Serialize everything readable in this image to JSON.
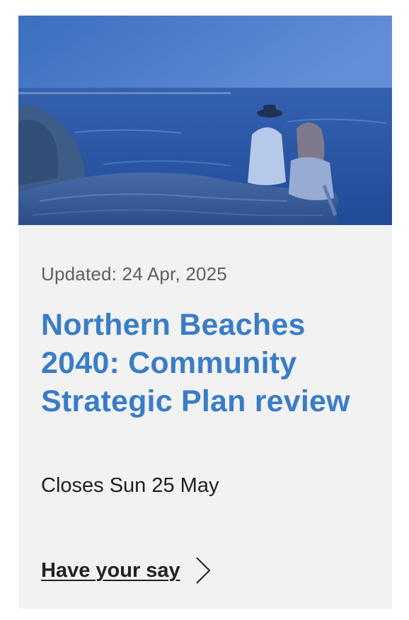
{
  "card": {
    "image": {
      "alt_icon": "coastal-cliff-photo",
      "overlay_color": "#2f6fd0"
    },
    "updated_text": "Updated: 24 Apr, 2025",
    "title": "Northern Beaches 2040: Community Strategic Plan review",
    "closes_text": "Closes Sun 25 May",
    "cta_label": "Have your say",
    "cta_icon": "chevron-right-icon"
  },
  "colors": {
    "title": "#3a7dc6",
    "card_background": "#f2f2f2",
    "meta_text": "#5f5f5f",
    "body_text": "#1e1e1e"
  }
}
